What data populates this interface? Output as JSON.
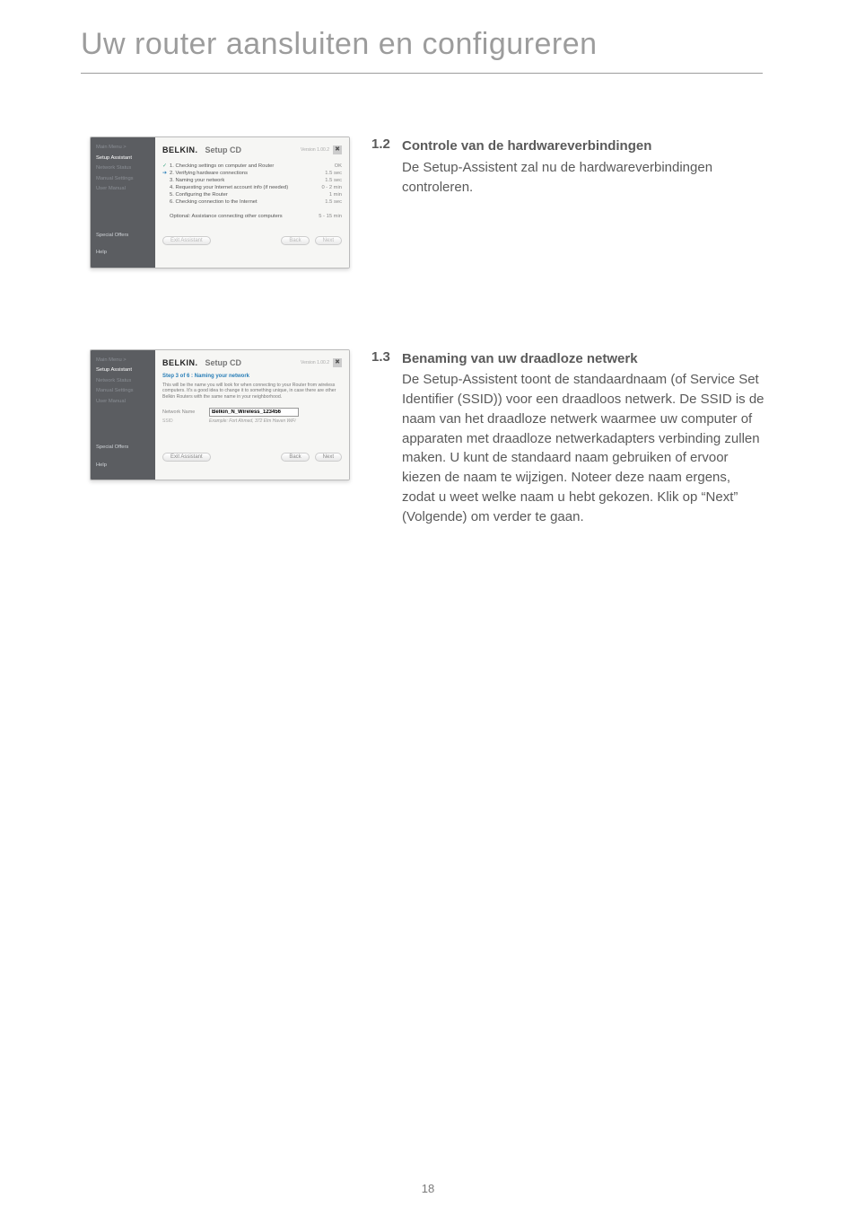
{
  "page": {
    "title": "Uw router aansluiten en configureren",
    "number": "18"
  },
  "sections": [
    {
      "num": "1.2",
      "heading": "Controle van de hardwareverbindingen",
      "body": "De Setup-Assistent zal nu de hardwareverbindingen controleren."
    },
    {
      "num": "1.3",
      "heading": "Benaming van uw draadloze netwerk",
      "body": "De Setup-Assistent toont de standaardnaam (of Service Set Identifier (SSID)) voor een draadloos netwerk. De SSID is de naam van het draadloze netwerk waarmee uw computer of apparaten met draadloze netwerkadapters verbinding zullen maken. U kunt de standaard naam gebruiken of ervoor kiezen de naam te wijzigen. Noteer deze naam ergens, zodat u weet welke naam u hebt gekozen. Klik op “Next” (Volgende) om verder te gaan."
    }
  ],
  "shot_common": {
    "brand": "BELKIN.",
    "window_title": "Setup CD",
    "version": "Version 1.00.2",
    "close_glyph": "✖",
    "sidebar": {
      "main_menu": "Main Menu >",
      "setup": "Setup Assistant",
      "status": "Network Status",
      "manual_set": "Manual Settings",
      "user_manual": "User Manual",
      "special": "Special Offers",
      "help": "Help"
    },
    "buttons": {
      "exit": "Exit Assistant",
      "back": "Back",
      "next": "Next"
    }
  },
  "shot1": {
    "steps": [
      {
        "icon": "✓",
        "label": "1. Checking settings on computer and Router",
        "dur": "OK"
      },
      {
        "icon": "➔",
        "label": "2. Verifying hardware connections",
        "dur": "1.5 sec"
      },
      {
        "icon": "",
        "label": "3. Naming your network",
        "dur": "1.5 sec"
      },
      {
        "icon": "",
        "label": "4. Requesting your Internet account info (if needed)",
        "dur": "0 - 2 min"
      },
      {
        "icon": "",
        "label": "5. Configuring the Router",
        "dur": "1 min"
      },
      {
        "icon": "",
        "label": "6. Checking connection to the Internet",
        "dur": "1.5 sec"
      }
    ],
    "optional": {
      "label": "Optional: Assistance connecting other computers",
      "dur": "5 - 15 min"
    }
  },
  "shot2": {
    "step_title": "Step 3 of 6 : Naming your network",
    "desc": "This will be the name you will look for when connecting to your Router from wireless computers. It's a good idea to change it to something unique, in case there are other Belkin Routers with the same name in your neighborhood.",
    "network_label": "Network Name",
    "network_value": "Belkin_N_Wireless_123456",
    "ssid_label": "SSID",
    "example": "Example: Fort Ahmed, 372 Elm Haven WiFi"
  }
}
